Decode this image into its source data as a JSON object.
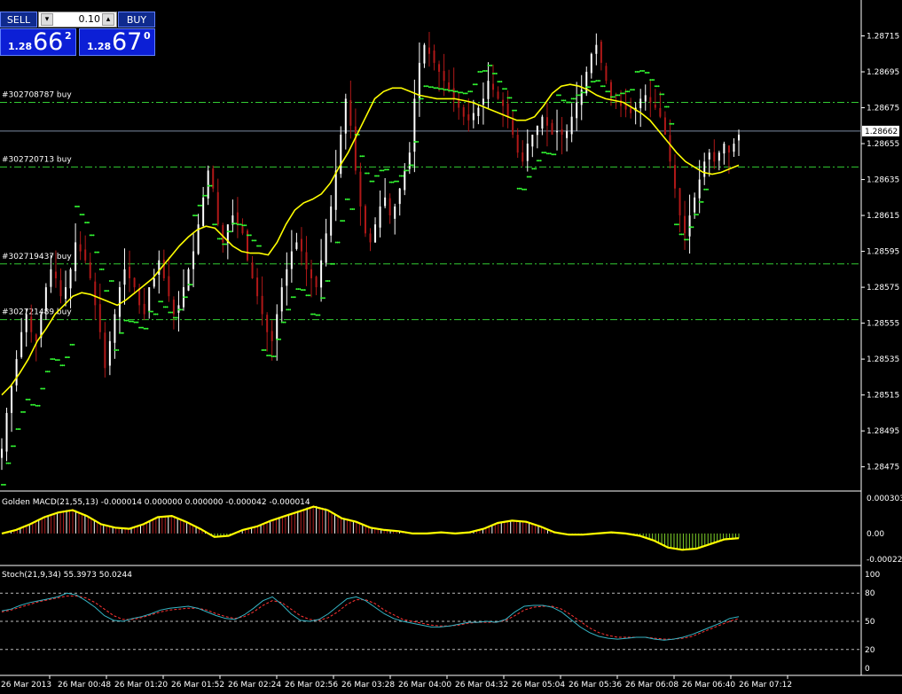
{
  "trade_panel": {
    "sell_label": "SELL",
    "buy_label": "BUY",
    "lot_value": "0.10",
    "sell_quote": {
      "prefix": "1.28",
      "big": "66",
      "sup": "2"
    },
    "buy_quote": {
      "prefix": "1.28",
      "big": "67",
      "sup": "0"
    }
  },
  "colors": {
    "bull_candle": "#ffffff",
    "bear_candle": "#b01818",
    "moving_average": "#ffff00",
    "parabolic_sar": "#33ff33",
    "order_line": "#33cc33",
    "axis": "#ffffff",
    "stoch_main": "#35b5c5",
    "stoch_signal": "#ff3333",
    "macd_signal": "#ffff00",
    "macd_hist_up": "#b02020",
    "macd_hist_down": "#7fd12a"
  },
  "chart_data": [
    {
      "type": "candlestick",
      "y_ticks": [
        "1.28715",
        "1.28695",
        "1.28675",
        "1.28655",
        "1.28635",
        "1.28615",
        "1.28595",
        "1.28575",
        "1.28555",
        "1.28535",
        "1.28515",
        "1.28495",
        "1.28475"
      ],
      "ylim": [
        1.28462,
        1.28735
      ],
      "x_ticks": [
        "26 Mar 2013",
        "26 Mar 00:48",
        "26 Mar 01:20",
        "26 Mar 01:52",
        "26 Mar 02:24",
        "26 Mar 02:56",
        "26 Mar 03:28",
        "26 Mar 04:00",
        "26 Mar 04:32",
        "26 Mar 05:04",
        "26 Mar 05:36",
        "26 Mar 06:08",
        "26 Mar 06:40",
        "26 Mar 07:12"
      ],
      "current_price_label": "1.28662",
      "current_price": 1.28662,
      "order_lines": [
        {
          "label": "#302708787 buy",
          "price": 1.28678
        },
        {
          "label": "#302720713 buy",
          "price": 1.28642
        },
        {
          "label": "#302719437 buy",
          "price": 1.28588
        },
        {
          "label": "#302721489 buy",
          "price": 1.28557
        }
      ],
      "series": [
        {
          "name": "price",
          "values": [
            1.28485,
            1.28505,
            1.2852,
            1.28535,
            1.2855,
            1.2856,
            1.2855,
            1.28545,
            1.2856,
            1.28575,
            1.28585,
            1.2858,
            1.2857,
            1.28575,
            1.28585,
            1.286,
            1.28595,
            1.2859,
            1.2858,
            1.28565,
            1.2855,
            1.2853,
            1.28545,
            1.2856,
            1.28575,
            1.28585,
            1.2858,
            1.28575,
            1.28565,
            1.2856,
            1.28575,
            1.2858,
            1.2859,
            1.2858,
            1.2857,
            1.2856,
            1.28565,
            1.28575,
            1.28585,
            1.28595,
            1.2861,
            1.28625,
            1.2864,
            1.2863,
            1.2861,
            1.286,
            1.2861,
            1.28615,
            1.2861,
            1.28605,
            1.2859,
            1.2858,
            1.2857,
            1.2856,
            1.2855,
            1.28545,
            1.2856,
            1.28575,
            1.28585,
            1.28595,
            1.286,
            1.28595,
            1.28585,
            1.2858,
            1.28575,
            1.2859,
            1.28605,
            1.2862,
            1.2864,
            1.2866,
            1.2868,
            1.28665,
            1.2864,
            1.2862,
            1.28605,
            1.286,
            1.2861,
            1.2862,
            1.28625,
            1.28615,
            1.2862,
            1.2863,
            1.2864,
            1.2865,
            1.2868,
            1.287,
            1.2871,
            1.28705,
            1.287,
            1.28695,
            1.2869,
            1.28685,
            1.2868,
            1.28675,
            1.2867,
            1.28668,
            1.28672,
            1.28675,
            1.2868,
            1.2869,
            1.28685,
            1.2868,
            1.28676,
            1.2867,
            1.2866,
            1.2865,
            1.28645,
            1.28655,
            1.2866,
            1.28665,
            1.2867,
            1.28665,
            1.2866,
            1.28662,
            1.2866,
            1.28662,
            1.2867,
            1.28678,
            1.28685,
            1.28695,
            1.28705,
            1.2871,
            1.287,
            1.2869,
            1.2868,
            1.28678,
            1.28676,
            1.28674,
            1.28672,
            1.28675,
            1.2868,
            1.28682,
            1.28678,
            1.28675,
            1.2867,
            1.2866,
            1.28645,
            1.2863,
            1.28615,
            1.28605,
            1.28615,
            1.28625,
            1.28635,
            1.28645,
            1.2865,
            1.28645,
            1.2865,
            1.28655,
            1.2865,
            1.28655,
            1.2866
          ]
        },
        {
          "name": "ma",
          "values": [
            1.28515,
            1.2852,
            1.28527,
            1.28535,
            1.28545,
            1.28552,
            1.2856,
            1.28565,
            1.2857,
            1.28572,
            1.28571,
            1.28569,
            1.28567,
            1.28565,
            1.28568,
            1.28572,
            1.28576,
            1.2858,
            1.28586,
            1.28592,
            1.28598,
            1.28603,
            1.28607,
            1.28609,
            1.28608,
            1.28603,
            1.28598,
            1.28595,
            1.28594,
            1.28594,
            1.28593,
            1.286,
            1.2861,
            1.28618,
            1.28622,
            1.28624,
            1.28627,
            1.28633,
            1.28642,
            1.2865,
            1.2866,
            1.2867,
            1.2868,
            1.28684,
            1.28686,
            1.28686,
            1.28684,
            1.28682,
            1.28681,
            1.2868,
            1.2868,
            1.2868,
            1.28679,
            1.28678,
            1.28676,
            1.28674,
            1.28672,
            1.2867,
            1.28668,
            1.28668,
            1.2867,
            1.28676,
            1.28683,
            1.28687,
            1.28688,
            1.28687,
            1.28685,
            1.28682,
            1.2868,
            1.28679,
            1.28678,
            1.28675,
            1.28672,
            1.28668,
            1.28662,
            1.28656,
            1.2865,
            1.28645,
            1.28642,
            1.28639,
            1.28638,
            1.28639,
            1.28641,
            1.28643
          ]
        }
      ]
    },
    {
      "type": "bar",
      "title": "Golden MACD(21,55,13) -0.000014 0.000000 0.000000 -0.000042 -0.000014",
      "y_ticks": [
        "0.000303",
        "0.00",
        "-0.000221"
      ],
      "ylim": [
        -0.000221,
        0.000303
      ],
      "series": [
        {
          "name": "signal",
          "values": [
            0.0,
            3e-05,
            8e-05,
            0.00014,
            0.00018,
            0.0002,
            0.00015,
            8e-05,
            5e-05,
            4e-05,
            8e-05,
            0.00014,
            0.00015,
            0.0001,
            4e-05,
            -3e-05,
            -2e-05,
            3e-05,
            6e-05,
            0.00011,
            0.00015,
            0.00019,
            0.00023,
            0.0002,
            0.00013,
            0.0001,
            5e-05,
            3e-05,
            2e-05,
            0.0,
            0.0,
            1e-05,
            0.0,
            1e-05,
            4e-05,
            9e-05,
            0.00011,
            0.0001,
            6e-05,
            1e-05,
            -1e-05,
            -1e-05,
            0.0,
            1e-05,
            0.0,
            -2e-05,
            -6e-05,
            -0.00012,
            -0.00014,
            -0.00013,
            -9e-05,
            -5e-05,
            -4e-05
          ]
        }
      ]
    },
    {
      "type": "line",
      "title": "Stoch(21,9,34) 55.3973 50.0244",
      "y_ticks": [
        "100",
        "80",
        "50",
        "20",
        "0"
      ],
      "ylim": [
        0,
        100
      ],
      "series": [
        {
          "name": "main",
          "values": [
            61,
            63,
            67,
            70,
            72,
            74,
            76,
            80,
            78,
            72,
            65,
            56,
            51,
            50,
            53,
            55,
            58,
            62,
            64,
            65,
            66,
            64,
            60,
            56,
            53,
            52,
            57,
            64,
            72,
            76,
            68,
            58,
            51,
            50,
            52,
            58,
            66,
            74,
            76,
            72,
            65,
            58,
            53,
            50,
            48,
            46,
            44,
            44,
            45,
            47,
            49,
            49,
            50,
            49,
            52,
            60,
            66,
            67,
            67,
            65,
            60,
            52,
            44,
            38,
            34,
            32,
            31,
            32,
            33,
            33,
            31,
            30,
            31,
            33,
            36,
            40,
            44,
            48,
            53,
            55
          ]
        },
        {
          "name": "signal",
          "values": [
            60,
            62,
            65,
            68,
            71,
            73,
            75,
            77,
            77,
            75,
            70,
            63,
            56,
            52,
            52,
            54,
            57,
            60,
            62,
            63,
            64,
            64,
            62,
            58,
            55,
            53,
            55,
            60,
            67,
            72,
            70,
            63,
            56,
            52,
            51,
            54,
            60,
            68,
            73,
            73,
            69,
            62,
            57,
            52,
            50,
            48,
            46,
            45,
            45,
            46,
            48,
            49,
            49,
            49,
            51,
            56,
            62,
            65,
            66,
            66,
            63,
            57,
            50,
            43,
            38,
            35,
            33,
            33,
            33,
            33,
            32,
            31,
            31,
            32,
            34,
            38,
            42,
            46,
            50,
            53
          ]
        }
      ]
    }
  ]
}
